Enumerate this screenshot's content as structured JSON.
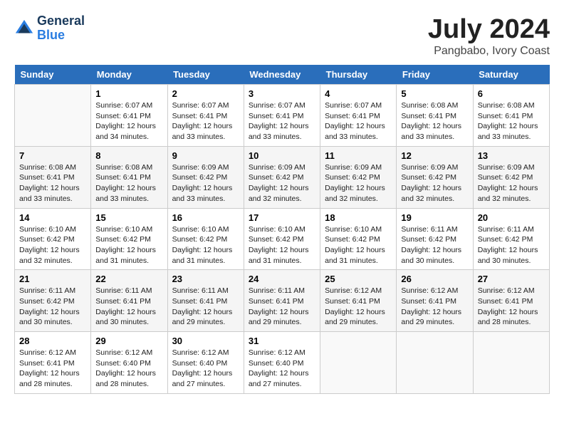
{
  "header": {
    "logo_line1": "General",
    "logo_line2": "Blue",
    "title": "July 2024",
    "subtitle": "Pangbabo, Ivory Coast"
  },
  "columns": [
    "Sunday",
    "Monday",
    "Tuesday",
    "Wednesday",
    "Thursday",
    "Friday",
    "Saturday"
  ],
  "weeks": [
    {
      "days": [
        {
          "number": "",
          "empty": true
        },
        {
          "number": "1",
          "sunrise": "Sunrise: 6:07 AM",
          "sunset": "Sunset: 6:41 PM",
          "daylight": "Daylight: 12 hours and 34 minutes."
        },
        {
          "number": "2",
          "sunrise": "Sunrise: 6:07 AM",
          "sunset": "Sunset: 6:41 PM",
          "daylight": "Daylight: 12 hours and 33 minutes."
        },
        {
          "number": "3",
          "sunrise": "Sunrise: 6:07 AM",
          "sunset": "Sunset: 6:41 PM",
          "daylight": "Daylight: 12 hours and 33 minutes."
        },
        {
          "number": "4",
          "sunrise": "Sunrise: 6:07 AM",
          "sunset": "Sunset: 6:41 PM",
          "daylight": "Daylight: 12 hours and 33 minutes."
        },
        {
          "number": "5",
          "sunrise": "Sunrise: 6:08 AM",
          "sunset": "Sunset: 6:41 PM",
          "daylight": "Daylight: 12 hours and 33 minutes."
        },
        {
          "number": "6",
          "sunrise": "Sunrise: 6:08 AM",
          "sunset": "Sunset: 6:41 PM",
          "daylight": "Daylight: 12 hours and 33 minutes."
        }
      ]
    },
    {
      "days": [
        {
          "number": "7",
          "sunrise": "Sunrise: 6:08 AM",
          "sunset": "Sunset: 6:41 PM",
          "daylight": "Daylight: 12 hours and 33 minutes."
        },
        {
          "number": "8",
          "sunrise": "Sunrise: 6:08 AM",
          "sunset": "Sunset: 6:41 PM",
          "daylight": "Daylight: 12 hours and 33 minutes."
        },
        {
          "number": "9",
          "sunrise": "Sunrise: 6:09 AM",
          "sunset": "Sunset: 6:42 PM",
          "daylight": "Daylight: 12 hours and 33 minutes."
        },
        {
          "number": "10",
          "sunrise": "Sunrise: 6:09 AM",
          "sunset": "Sunset: 6:42 PM",
          "daylight": "Daylight: 12 hours and 32 minutes."
        },
        {
          "number": "11",
          "sunrise": "Sunrise: 6:09 AM",
          "sunset": "Sunset: 6:42 PM",
          "daylight": "Daylight: 12 hours and 32 minutes."
        },
        {
          "number": "12",
          "sunrise": "Sunrise: 6:09 AM",
          "sunset": "Sunset: 6:42 PM",
          "daylight": "Daylight: 12 hours and 32 minutes."
        },
        {
          "number": "13",
          "sunrise": "Sunrise: 6:09 AM",
          "sunset": "Sunset: 6:42 PM",
          "daylight": "Daylight: 12 hours and 32 minutes."
        }
      ]
    },
    {
      "days": [
        {
          "number": "14",
          "sunrise": "Sunrise: 6:10 AM",
          "sunset": "Sunset: 6:42 PM",
          "daylight": "Daylight: 12 hours and 32 minutes."
        },
        {
          "number": "15",
          "sunrise": "Sunrise: 6:10 AM",
          "sunset": "Sunset: 6:42 PM",
          "daylight": "Daylight: 12 hours and 31 minutes."
        },
        {
          "number": "16",
          "sunrise": "Sunrise: 6:10 AM",
          "sunset": "Sunset: 6:42 PM",
          "daylight": "Daylight: 12 hours and 31 minutes."
        },
        {
          "number": "17",
          "sunrise": "Sunrise: 6:10 AM",
          "sunset": "Sunset: 6:42 PM",
          "daylight": "Daylight: 12 hours and 31 minutes."
        },
        {
          "number": "18",
          "sunrise": "Sunrise: 6:10 AM",
          "sunset": "Sunset: 6:42 PM",
          "daylight": "Daylight: 12 hours and 31 minutes."
        },
        {
          "number": "19",
          "sunrise": "Sunrise: 6:11 AM",
          "sunset": "Sunset: 6:42 PM",
          "daylight": "Daylight: 12 hours and 30 minutes."
        },
        {
          "number": "20",
          "sunrise": "Sunrise: 6:11 AM",
          "sunset": "Sunset: 6:42 PM",
          "daylight": "Daylight: 12 hours and 30 minutes."
        }
      ]
    },
    {
      "days": [
        {
          "number": "21",
          "sunrise": "Sunrise: 6:11 AM",
          "sunset": "Sunset: 6:42 PM",
          "daylight": "Daylight: 12 hours and 30 minutes."
        },
        {
          "number": "22",
          "sunrise": "Sunrise: 6:11 AM",
          "sunset": "Sunset: 6:41 PM",
          "daylight": "Daylight: 12 hours and 30 minutes."
        },
        {
          "number": "23",
          "sunrise": "Sunrise: 6:11 AM",
          "sunset": "Sunset: 6:41 PM",
          "daylight": "Daylight: 12 hours and 29 minutes."
        },
        {
          "number": "24",
          "sunrise": "Sunrise: 6:11 AM",
          "sunset": "Sunset: 6:41 PM",
          "daylight": "Daylight: 12 hours and 29 minutes."
        },
        {
          "number": "25",
          "sunrise": "Sunrise: 6:12 AM",
          "sunset": "Sunset: 6:41 PM",
          "daylight": "Daylight: 12 hours and 29 minutes."
        },
        {
          "number": "26",
          "sunrise": "Sunrise: 6:12 AM",
          "sunset": "Sunset: 6:41 PM",
          "daylight": "Daylight: 12 hours and 29 minutes."
        },
        {
          "number": "27",
          "sunrise": "Sunrise: 6:12 AM",
          "sunset": "Sunset: 6:41 PM",
          "daylight": "Daylight: 12 hours and 28 minutes."
        }
      ]
    },
    {
      "days": [
        {
          "number": "28",
          "sunrise": "Sunrise: 6:12 AM",
          "sunset": "Sunset: 6:41 PM",
          "daylight": "Daylight: 12 hours and 28 minutes."
        },
        {
          "number": "29",
          "sunrise": "Sunrise: 6:12 AM",
          "sunset": "Sunset: 6:40 PM",
          "daylight": "Daylight: 12 hours and 28 minutes."
        },
        {
          "number": "30",
          "sunrise": "Sunrise: 6:12 AM",
          "sunset": "Sunset: 6:40 PM",
          "daylight": "Daylight: 12 hours and 27 minutes."
        },
        {
          "number": "31",
          "sunrise": "Sunrise: 6:12 AM",
          "sunset": "Sunset: 6:40 PM",
          "daylight": "Daylight: 12 hours and 27 minutes."
        },
        {
          "number": "",
          "empty": true
        },
        {
          "number": "",
          "empty": true
        },
        {
          "number": "",
          "empty": true
        }
      ]
    }
  ]
}
